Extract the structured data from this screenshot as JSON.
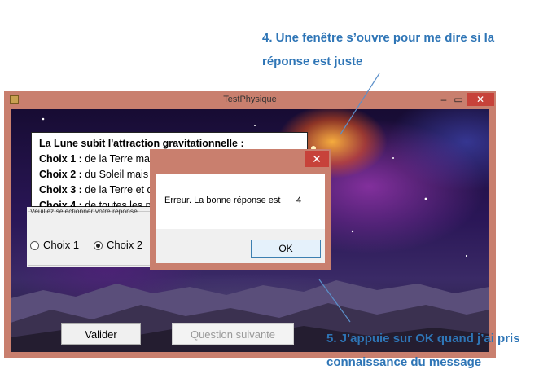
{
  "annotations": {
    "step4_line1": "4. Une fenêtre s’ouvre pour me dire si la",
    "step4_line2": "réponse est juste",
    "step5_line1": "5. J’appuie sur OK quand j’ai pris",
    "step5_line2": "connaissance du message",
    "color": "#2e75b6"
  },
  "window": {
    "title": "TestPhysique",
    "minimize_glyph": "–",
    "maximize_glyph": "▭",
    "close_glyph": "✕",
    "frame_color": "#c97f6e"
  },
  "question": {
    "text": "La Lune subit l'attraction gravitationnelle :",
    "choices": [
      {
        "label": "Choix 1 :",
        "text": " de la Terre mais pas celle du Soleil."
      },
      {
        "label": "Choix 2 :",
        "text": " du Soleil mais p"
      },
      {
        "label": "Choix 3 :",
        "text": " de la Terre et du"
      },
      {
        "label": "Choix 4 :",
        "text": " de toutes les pla"
      }
    ]
  },
  "choice_group": {
    "legend": "Veuillez sélectionner votre réponse",
    "options": [
      {
        "label": "Choix 1",
        "checked": false
      },
      {
        "label": "Choix 2",
        "checked": true
      }
    ]
  },
  "buttons": {
    "validate": "Valider",
    "next_question": "Question suivante"
  },
  "dialog": {
    "close_glyph": "✕",
    "message": "Erreur. La bonne réponse est",
    "answer": "4",
    "ok": "OK"
  }
}
